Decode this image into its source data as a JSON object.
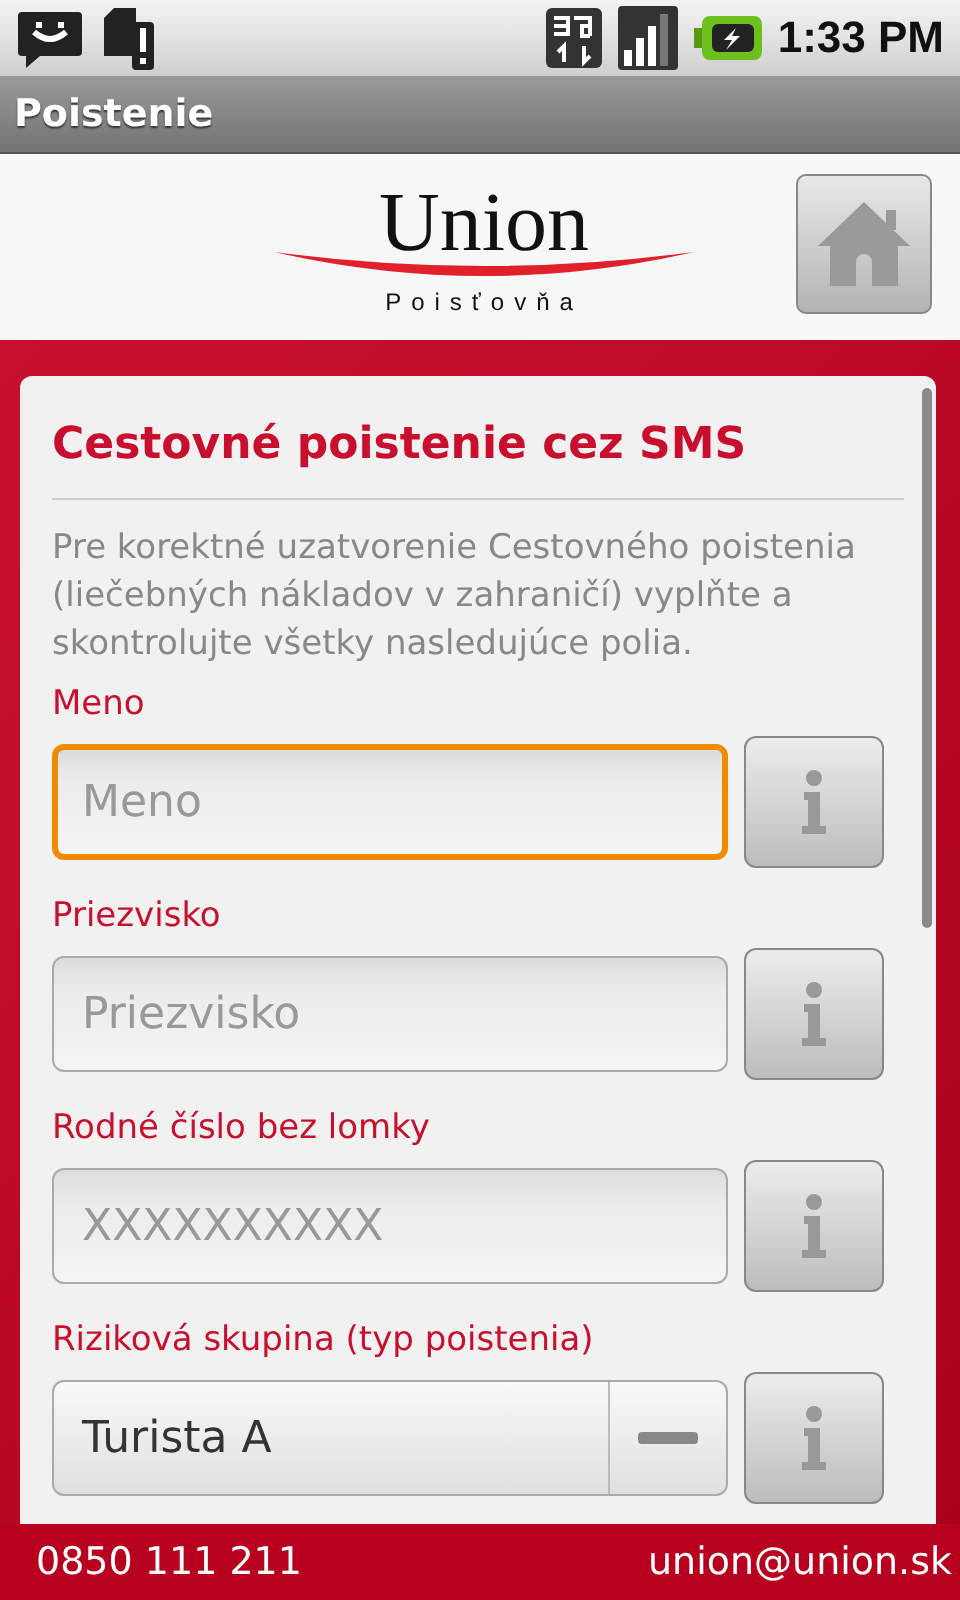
{
  "status_bar": {
    "time": "1:33 PM"
  },
  "title_bar": {
    "title": "Poistenie"
  },
  "header": {
    "logo_name": "Union",
    "logo_subtitle": "Poisťovňa"
  },
  "form": {
    "title": "Cestovné poistenie cez SMS",
    "intro": "Pre korektné uzatvorenie Cestovného poistenia (liečebných nákladov v zahraničí) vyplňte a skontrolujte všetky nasledujúce polia.",
    "fields": [
      {
        "kind": "text",
        "label": "Meno",
        "placeholder": "Meno",
        "focused": true
      },
      {
        "kind": "text",
        "label": "Priezvisko",
        "placeholder": "Priezvisko",
        "focused": false
      },
      {
        "kind": "text",
        "label": "Rodné číslo bez lomky",
        "placeholder": "XXXXXXXXXX",
        "focused": false
      },
      {
        "kind": "select",
        "label": "Riziková skupina (typ poistenia)",
        "value": "Turista A",
        "focused": false
      }
    ]
  },
  "footer": {
    "phone": "0850 111 211",
    "email": "union@union.sk"
  }
}
